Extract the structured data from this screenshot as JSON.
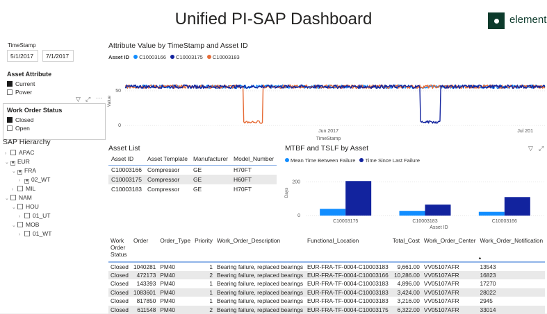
{
  "header": {
    "title": "Unified PI-SAP Dashboard",
    "logo_text": "element"
  },
  "timestamp": {
    "label": "TimeStamp",
    "start": "5/1/2017",
    "end": "7/1/2017"
  },
  "asset_attribute": {
    "label": "Asset Attribute",
    "options": [
      {
        "label": "Current",
        "checked": true
      },
      {
        "label": "Power",
        "checked": false
      }
    ]
  },
  "work_order_status": {
    "label": "Work Order Status",
    "options": [
      {
        "label": "Closed",
        "checked": true
      },
      {
        "label": "Open",
        "checked": false
      }
    ]
  },
  "hierarchy": {
    "label": "SAP Hierarchy",
    "nodes": [
      "APAC",
      "EUR",
      "FRA",
      "02_WT",
      "MIL",
      "NAM",
      "HOU",
      "01_UT",
      "MOB",
      "01_WT"
    ]
  },
  "line_chart": {
    "title": "Attribute Value by TimeStamp and Asset ID",
    "legend_title": "Asset ID",
    "ylabel": "Value",
    "xlabel": "TimeStamp",
    "y_ticks": [
      "50",
      "0"
    ],
    "x_ticks": [
      "Jun 2017",
      "Jul 201"
    ]
  },
  "asset_list": {
    "title": "Asset List",
    "columns": [
      "Asset ID",
      "Asset Template",
      "Manufacturer",
      "Model_Number"
    ],
    "rows": [
      [
        "C10003166",
        "Compressor",
        "GE",
        "H70FT"
      ],
      [
        "C10003175",
        "Compressor",
        "GE",
        "H60FT"
      ],
      [
        "C10003183",
        "Compressor",
        "GE",
        "H70FT"
      ]
    ]
  },
  "mtbf_chart": {
    "title": "MTBF and TSLF by Asset",
    "series_names": [
      "Mean Time Between Failure",
      "Time Since Last Failure"
    ],
    "ylabel": "Days",
    "xlabel": "Asset ID",
    "y_ticks": [
      "200",
      "0"
    ]
  },
  "work_orders": {
    "columns": [
      "Work Order Status",
      "Order",
      "Order_Type",
      "Priority",
      "Work_Order_Description",
      "Functional_Location",
      "Total_Cost",
      "Work_Order_Center",
      "Work_Order_Notification"
    ],
    "rows": [
      [
        "Closed",
        "1040281",
        "PM40",
        "1",
        "Bearing failure, replaced bearings",
        "EUR-FRA-TF-0004-C10003183",
        "9,661.00",
        "VV05107AFR",
        "13543"
      ],
      [
        "Closed",
        "472173",
        "PM40",
        "2",
        "Bearing failure, replaced bearings",
        "EUR-FRA-TF-0004-C10003166",
        "10,286.00",
        "VV05107AFR",
        "16823"
      ],
      [
        "Closed",
        "143393",
        "PM40",
        "1",
        "Bearing failure, replaced bearings",
        "EUR-FRA-TF-0004-C10003183",
        "4,896.00",
        "VV05107AFR",
        "17270"
      ],
      [
        "Closed",
        "1083601",
        "PM40",
        "1",
        "Bearing failure, replaced bearings",
        "EUR-FRA-TF-0004-C10003183",
        "3,424.00",
        "VV05107AFR",
        "28022"
      ],
      [
        "Closed",
        "817850",
        "PM40",
        "1",
        "Bearing failure, replaced bearings",
        "EUR-FRA-TF-0004-C10003183",
        "3,216.00",
        "VV05107AFR",
        "2945"
      ],
      [
        "Closed",
        "611548",
        "PM40",
        "2",
        "Bearing failure, replaced bearings",
        "EUR-FRA-TF-0004-C10003175",
        "6,322.00",
        "VV05107AFR",
        "33014"
      ]
    ]
  },
  "colors": {
    "c10003166": "#118dff",
    "c10003175": "#12239e",
    "c10003183": "#e66c37",
    "table_header_border": "#8fb3e8"
  },
  "chart_data": [
    {
      "type": "line",
      "title": "Attribute Value by TimeStamp and Asset ID",
      "xlabel": "TimeStamp",
      "ylabel": "Value",
      "x_range": [
        "2017-05-01",
        "2017-07-01"
      ],
      "ylim": [
        -5,
        75
      ],
      "series": [
        {
          "name": "C10003166",
          "baseline": 56,
          "noise": 2.5,
          "dropouts": []
        },
        {
          "name": "C10003175",
          "baseline": 56,
          "noise": 2.5,
          "dropouts": [
            {
              "from": "2017-06-15",
              "to": "2017-06-18",
              "value": 5
            }
          ]
        },
        {
          "name": "C10003183",
          "baseline": 56,
          "noise": 2.5,
          "dropouts": [
            {
              "from": "2017-05-19",
              "to": "2017-05-22",
              "value": 5
            }
          ]
        }
      ]
    },
    {
      "type": "bar",
      "title": "MTBF and TSLF by Asset",
      "xlabel": "Asset ID",
      "ylabel": "Days",
      "categories": [
        "C10003175",
        "C10003183",
        "C10003166"
      ],
      "ylim": [
        0,
        280
      ],
      "series": [
        {
          "name": "Mean Time Between Failure",
          "values": [
            40,
            28,
            22
          ]
        },
        {
          "name": "Time Since Last Failure",
          "values": [
            205,
            65,
            110
          ]
        }
      ]
    }
  ]
}
